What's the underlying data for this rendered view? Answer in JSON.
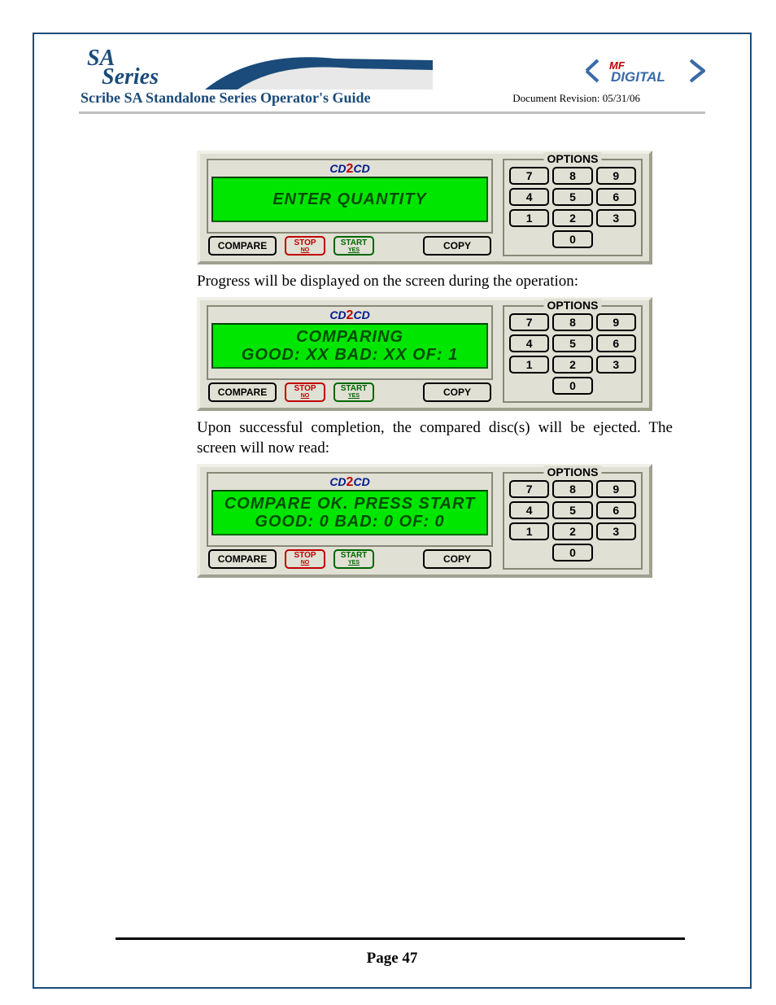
{
  "header": {
    "logo_sa": "SA",
    "logo_series": "Series",
    "mf_top": "MF",
    "mf_bottom": "DIGITAL",
    "title": "Scribe SA Standalone Series Operator's Guide",
    "revision": "Document Revision: 05/31/06"
  },
  "body_text": {
    "t1": "Progress will be displayed on the screen during the operation:",
    "t2": "Upon successful completion, the compared disc(s) will be ejected. The screen will now read:"
  },
  "panels": [
    {
      "lcd_brand_left": "CD",
      "lcd_brand_mid": "2",
      "lcd_brand_right": "CD",
      "line1": "ENTER QUANTITY",
      "line2": ""
    },
    {
      "lcd_brand_left": "CD",
      "lcd_brand_mid": "2",
      "lcd_brand_right": "CD",
      "line1": "COMPARING",
      "line2": "GOOD: XX   BAD: XX   OF: 1"
    },
    {
      "lcd_brand_left": "CD",
      "lcd_brand_mid": "2",
      "lcd_brand_right": "CD",
      "line1": "COMPARE OK. PRESS START",
      "line2": "GOOD: 0   BAD: 0   OF: 0"
    }
  ],
  "buttons": {
    "compare": "COMPARE",
    "stop": "STOP",
    "stop_sub": "NO",
    "start": "START",
    "start_sub": "YES",
    "copy": "COPY"
  },
  "options": {
    "label": "OPTIONS",
    "keys": [
      "7",
      "8",
      "9",
      "4",
      "5",
      "6",
      "1",
      "2",
      "3",
      "0"
    ]
  },
  "footer": {
    "page": "Page 47"
  }
}
